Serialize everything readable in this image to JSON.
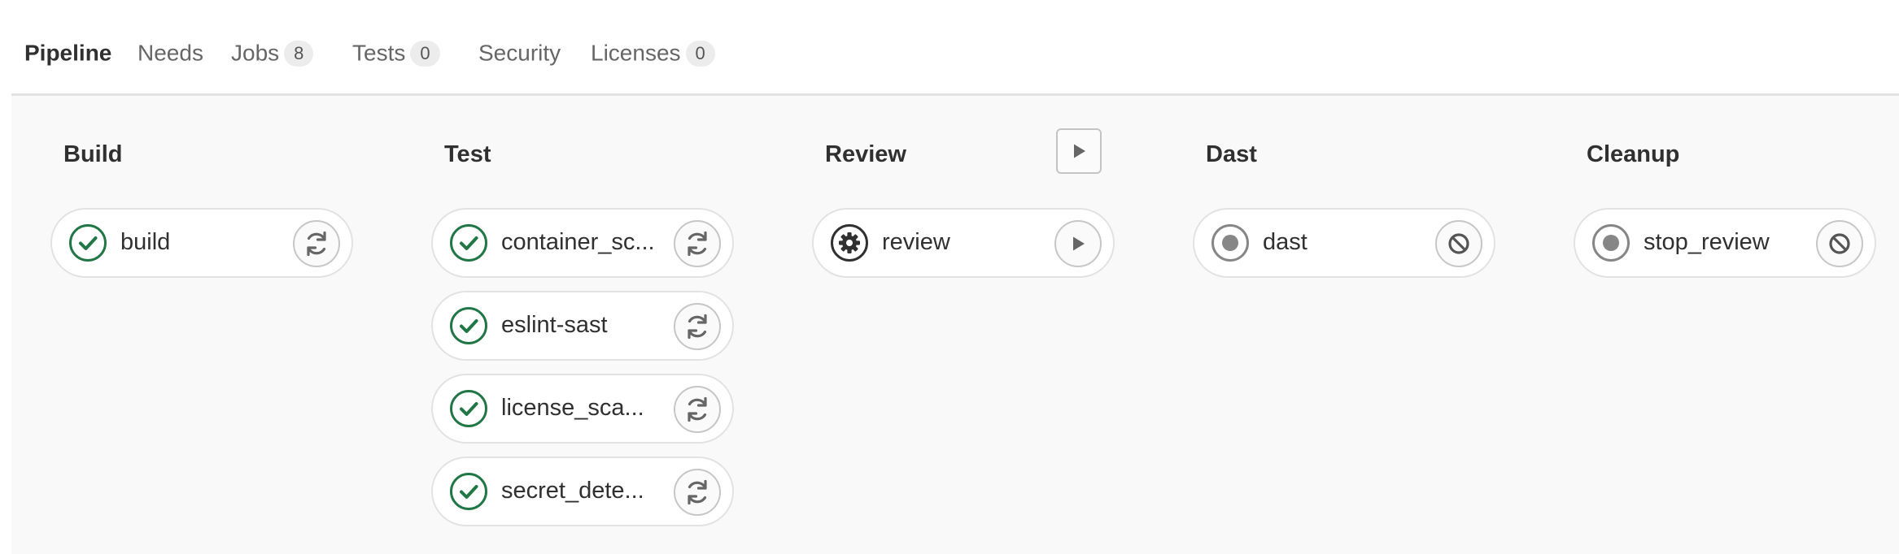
{
  "tabs": [
    {
      "label": "Pipeline",
      "active": true
    },
    {
      "label": "Needs"
    },
    {
      "label": "Jobs",
      "badge": "8"
    },
    {
      "label": "Tests",
      "badge": "0"
    },
    {
      "label": "Security"
    },
    {
      "label": "Licenses",
      "badge": "0"
    }
  ],
  "colors": {
    "success": "#217645",
    "neutral": "#868686",
    "manual": "#303030"
  },
  "stages": [
    {
      "name": "Build",
      "jobs": [
        {
          "name": "build",
          "status_icon": "status-success-icon",
          "action_icon": "retry-icon"
        }
      ]
    },
    {
      "name": "Test",
      "jobs": [
        {
          "name": "container_sc...",
          "status_icon": "status-success-icon",
          "action_icon": "retry-icon"
        },
        {
          "name": "eslint-sast",
          "status_icon": "status-success-icon",
          "action_icon": "retry-icon"
        },
        {
          "name": "license_sca...",
          "status_icon": "status-success-icon",
          "action_icon": "retry-icon"
        },
        {
          "name": "secret_dete...",
          "status_icon": "status-success-icon",
          "action_icon": "retry-icon"
        }
      ]
    },
    {
      "name": "Review",
      "stage_action_icon": "play-icon",
      "jobs": [
        {
          "name": "review",
          "status_icon": "status-manual-icon",
          "action_icon": "play-icon"
        }
      ]
    },
    {
      "name": "Dast",
      "jobs": [
        {
          "name": "dast",
          "status_icon": "status-skipped-icon",
          "action_icon": "cancel-icon"
        }
      ]
    },
    {
      "name": "Cleanup",
      "jobs": [
        {
          "name": "stop_review",
          "status_icon": "status-skipped-icon",
          "action_icon": "cancel-icon"
        }
      ]
    }
  ]
}
